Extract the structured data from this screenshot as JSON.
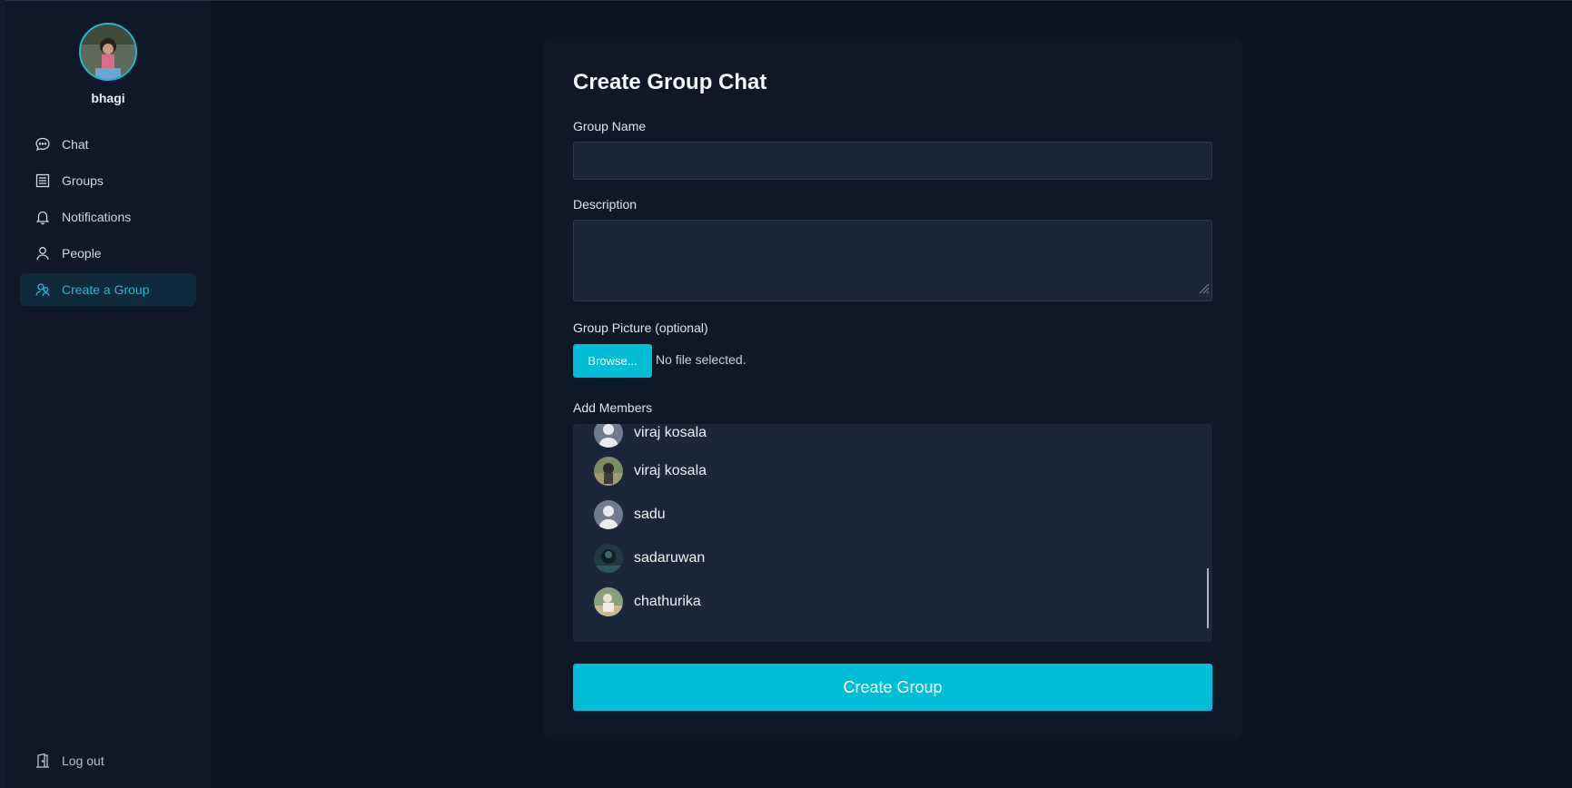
{
  "user": {
    "name": "bhagi"
  },
  "nav": {
    "items": [
      {
        "label": "Chat",
        "icon": "chat-bubble-icon"
      },
      {
        "label": "Groups",
        "icon": "groups-icon"
      },
      {
        "label": "Notifications",
        "icon": "bell-icon"
      },
      {
        "label": "People",
        "icon": "person-icon"
      },
      {
        "label": "Create a Group",
        "icon": "users-plus-icon",
        "active": true
      }
    ],
    "logout_label": "Log out"
  },
  "form": {
    "title": "Create Group Chat",
    "group_name_label": "Group Name",
    "group_name_value": "",
    "description_label": "Description",
    "description_value": "",
    "picture_label": "Group Picture (optional)",
    "browse_label": "Browse...",
    "no_file_text": "No file selected.",
    "members_label": "Add Members",
    "members": [
      {
        "name": "viraj kosala",
        "avatar": "default-avatar"
      },
      {
        "name": "viraj kosala",
        "avatar": "photo-avatar"
      },
      {
        "name": "sadu",
        "avatar": "default-avatar"
      },
      {
        "name": "sadaruwan",
        "avatar": "photo-avatar"
      },
      {
        "name": "chathurika",
        "avatar": "photo-avatar"
      }
    ],
    "submit_label": "Create Group"
  },
  "colors": {
    "accent": "#00bcd4",
    "background": "#0b1422",
    "panel": "#0e1829",
    "input": "#1a263a"
  }
}
